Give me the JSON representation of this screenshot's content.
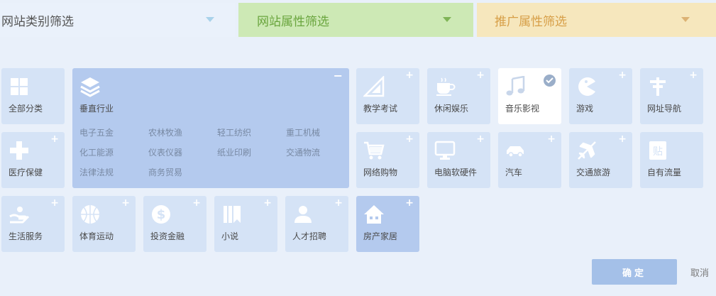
{
  "tabs": {
    "category": "网站类别筛选",
    "site": "网站属性筛选",
    "promo": "推广属性筛选"
  },
  "tiles": [
    {
      "label": "全部分类",
      "icon": "grid-icon"
    },
    {
      "label": "医疗保健",
      "icon": "medical-cross-icon"
    },
    {
      "label": "生活服务",
      "icon": "hand-service-icon"
    },
    {
      "label": "体育运动",
      "icon": "basketball-icon"
    },
    {
      "label": "投资金融",
      "icon": "dollar-icon"
    },
    {
      "label": "小说",
      "icon": "book-icon"
    },
    {
      "label": "人才招聘",
      "icon": "person-icon"
    },
    {
      "label": "房产家居",
      "icon": "house-icon"
    },
    {
      "label": "教学考试",
      "icon": "ruler-icon"
    },
    {
      "label": "休闲娱乐",
      "icon": "coffee-icon"
    },
    {
      "label": "音乐影视",
      "icon": "music-icon"
    },
    {
      "label": "游戏",
      "icon": "pacman-icon"
    },
    {
      "label": "网址导航",
      "icon": "signpost-icon"
    },
    {
      "label": "网络购物",
      "icon": "cart-icon"
    },
    {
      "label": "电脑软硬件",
      "icon": "monitor-icon"
    },
    {
      "label": "汽车",
      "icon": "car-icon"
    },
    {
      "label": "交通旅游",
      "icon": "plane-icon"
    },
    {
      "label": "自有流量",
      "icon": "sticker-icon"
    }
  ],
  "vertical": {
    "label": "垂直行业",
    "icon": "layers-icon",
    "subs": [
      "电子五金",
      "农林牧渔",
      "轻工纺织",
      "重工机械",
      "化工能源",
      "仪表仪器",
      "纸业印刷",
      "交通物流",
      "法律法规",
      "商务贸易"
    ]
  },
  "selected": "音乐影视",
  "active": "房产家居",
  "buttons": {
    "confirm": "确定",
    "cancel": "取消"
  },
  "colors": {
    "tile": "#d5e3f6",
    "active": "#b4caee",
    "selected": "#ffffff",
    "icon": "#ffffff",
    "confirm": "#a4c0e8"
  }
}
